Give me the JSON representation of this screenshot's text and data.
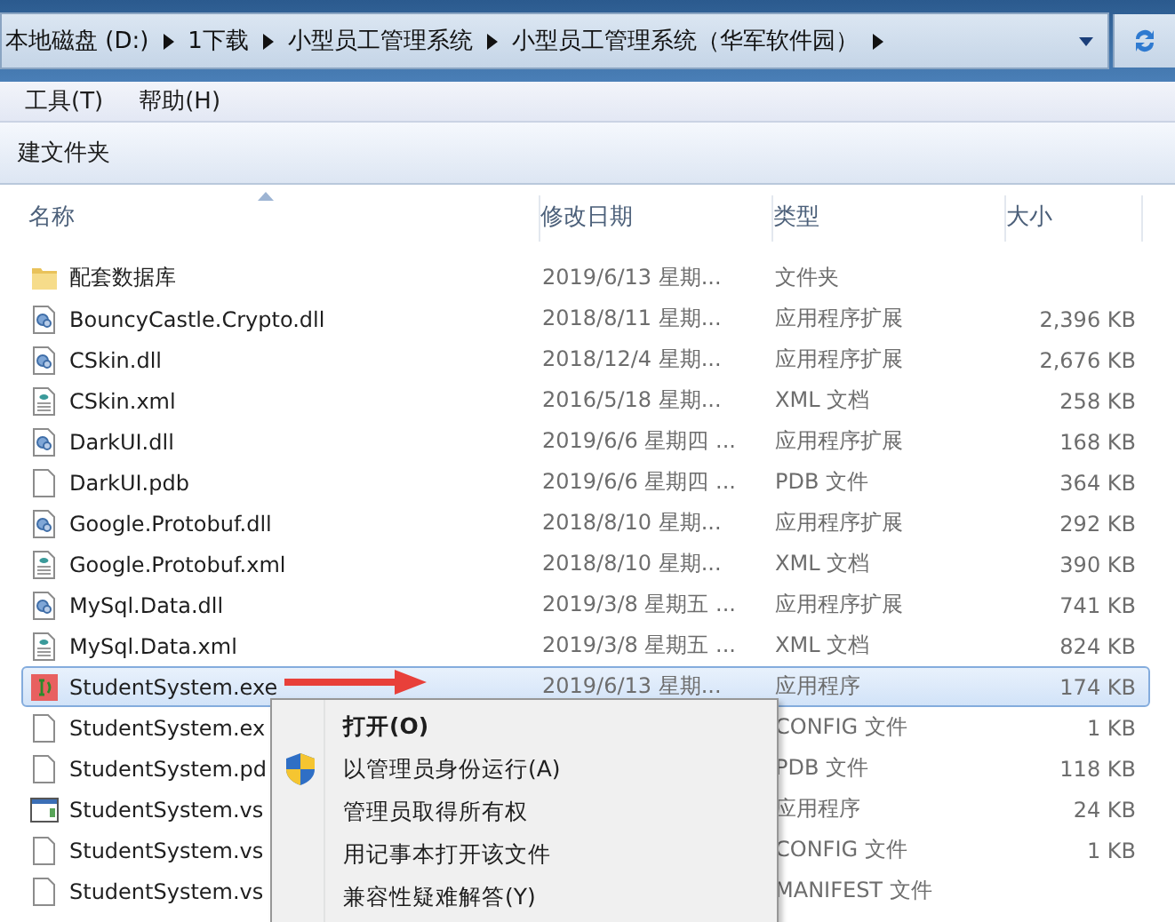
{
  "address_bar": {
    "crumbs": [
      "本地磁盘 (D:)",
      "1下载",
      "小型员工管理系统",
      "小型员工管理系统（华军软件园）"
    ]
  },
  "menu_bar": {
    "items": [
      "工具(T)",
      "帮助(H)"
    ]
  },
  "toolbar": {
    "items": [
      "建文件夹"
    ]
  },
  "table": {
    "columns": [
      {
        "label": "名称",
        "sorted": true
      },
      {
        "label": "修改日期",
        "sorted": false
      },
      {
        "label": "类型",
        "sorted": false
      },
      {
        "label": "大小",
        "sorted": false
      }
    ],
    "rows": [
      {
        "kind": "folder",
        "name": "配套数据库",
        "date": "2019/6/13 星期...",
        "type": "文件夹",
        "size": "",
        "selected": false
      },
      {
        "kind": "dll",
        "name": "BouncyCastle.Crypto.dll",
        "date": "2018/8/11 星期...",
        "type": "应用程序扩展",
        "size": "2,396 KB",
        "selected": false
      },
      {
        "kind": "dll",
        "name": "CSkin.dll",
        "date": "2018/12/4 星期...",
        "type": "应用程序扩展",
        "size": "2,676 KB",
        "selected": false
      },
      {
        "kind": "xml",
        "name": "CSkin.xml",
        "date": "2016/5/18 星期...",
        "type": "XML 文档",
        "size": "258 KB",
        "selected": false
      },
      {
        "kind": "dll",
        "name": "DarkUI.dll",
        "date": "2019/6/6 星期四 ...",
        "type": "应用程序扩展",
        "size": "168 KB",
        "selected": false
      },
      {
        "kind": "blank",
        "name": "DarkUI.pdb",
        "date": "2019/6/6 星期四 ...",
        "type": "PDB 文件",
        "size": "364 KB",
        "selected": false
      },
      {
        "kind": "dll",
        "name": "Google.Protobuf.dll",
        "date": "2018/8/10 星期...",
        "type": "应用程序扩展",
        "size": "292 KB",
        "selected": false
      },
      {
        "kind": "xml",
        "name": "Google.Protobuf.xml",
        "date": "2018/8/10 星期...",
        "type": "XML 文档",
        "size": "390 KB",
        "selected": false
      },
      {
        "kind": "dll",
        "name": "MySql.Data.dll",
        "date": "2019/3/8 星期五 ...",
        "type": "应用程序扩展",
        "size": "741 KB",
        "selected": false
      },
      {
        "kind": "xml",
        "name": "MySql.Data.xml",
        "date": "2019/3/8 星期五 ...",
        "type": "XML 文档",
        "size": "824 KB",
        "selected": false
      },
      {
        "kind": "exe",
        "name": "StudentSystem.exe",
        "date": "2019/6/13 星期...",
        "type": "应用程序",
        "size": "174 KB",
        "selected": true
      },
      {
        "kind": "blank",
        "name": "StudentSystem.ex",
        "type": "CONFIG 文件",
        "size": "1 KB",
        "selected": false
      },
      {
        "kind": "blank",
        "name": "StudentSystem.pd",
        "type": "PDB 文件",
        "size": "118 KB",
        "selected": false
      },
      {
        "kind": "app",
        "name": "StudentSystem.vs",
        "type": "应用程序",
        "size": "24 KB",
        "selected": false
      },
      {
        "kind": "blank",
        "name": "StudentSystem.vs",
        "type": "CONFIG 文件",
        "size": "1 KB",
        "selected": false
      },
      {
        "kind": "blank",
        "name": "StudentSystem.vs",
        "type": "MANIFEST 文件",
        "size": "",
        "selected": false
      }
    ]
  },
  "context_menu": {
    "items": [
      {
        "label": "打开(O)",
        "default": true,
        "shield": false
      },
      {
        "label": "以管理员身份运行(A)",
        "default": false,
        "shield": true
      },
      {
        "label": "管理员取得所有权",
        "default": false,
        "shield": false
      },
      {
        "label": "用记事本打开该文件",
        "default": false,
        "shield": false
      },
      {
        "label": "兼容性疑难解答(Y)",
        "default": false,
        "shield": false
      }
    ]
  }
}
